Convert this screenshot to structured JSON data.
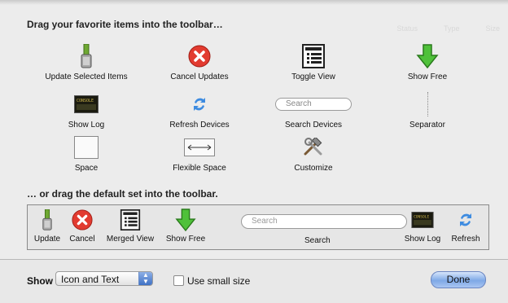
{
  "background_header": [
    "Status",
    "Type",
    "Size"
  ],
  "headings": {
    "drag_items": "Drag your favorite items into the toolbar…",
    "drag_default": "… or drag the default set into the toolbar."
  },
  "items": [
    {
      "label": "Update Selected Items",
      "icon": "update-icon"
    },
    {
      "label": "Cancel Updates",
      "icon": "cancel-icon"
    },
    {
      "label": "Toggle View",
      "icon": "toggle-view-icon"
    },
    {
      "label": "Show Free",
      "icon": "show-free-arrow-icon"
    },
    {
      "label": "Show Log",
      "icon": "console-icon"
    },
    {
      "label": "Refresh Devices",
      "icon": "refresh-icon"
    },
    {
      "label": "Search Devices",
      "icon": "search-field",
      "placeholder": "Search"
    },
    {
      "label": "Separator",
      "icon": "separator-icon"
    },
    {
      "label": "Space",
      "icon": "space-icon"
    },
    {
      "label": "Flexible Space",
      "icon": "flexible-space-icon"
    },
    {
      "label": "Customize",
      "icon": "customize-tools-icon"
    }
  ],
  "default_set": {
    "items": [
      "Update",
      "Cancel",
      "Merged View",
      "Show Free",
      "Show Log",
      "Refresh"
    ],
    "search_placeholder": "Search",
    "search_label": "Search"
  },
  "console_text": "CONSOLE",
  "bottom": {
    "show_label": "Show",
    "show_value": "Icon and Text",
    "small_size_label": "Use small size",
    "small_size_checked": false,
    "done_label": "Done"
  }
}
